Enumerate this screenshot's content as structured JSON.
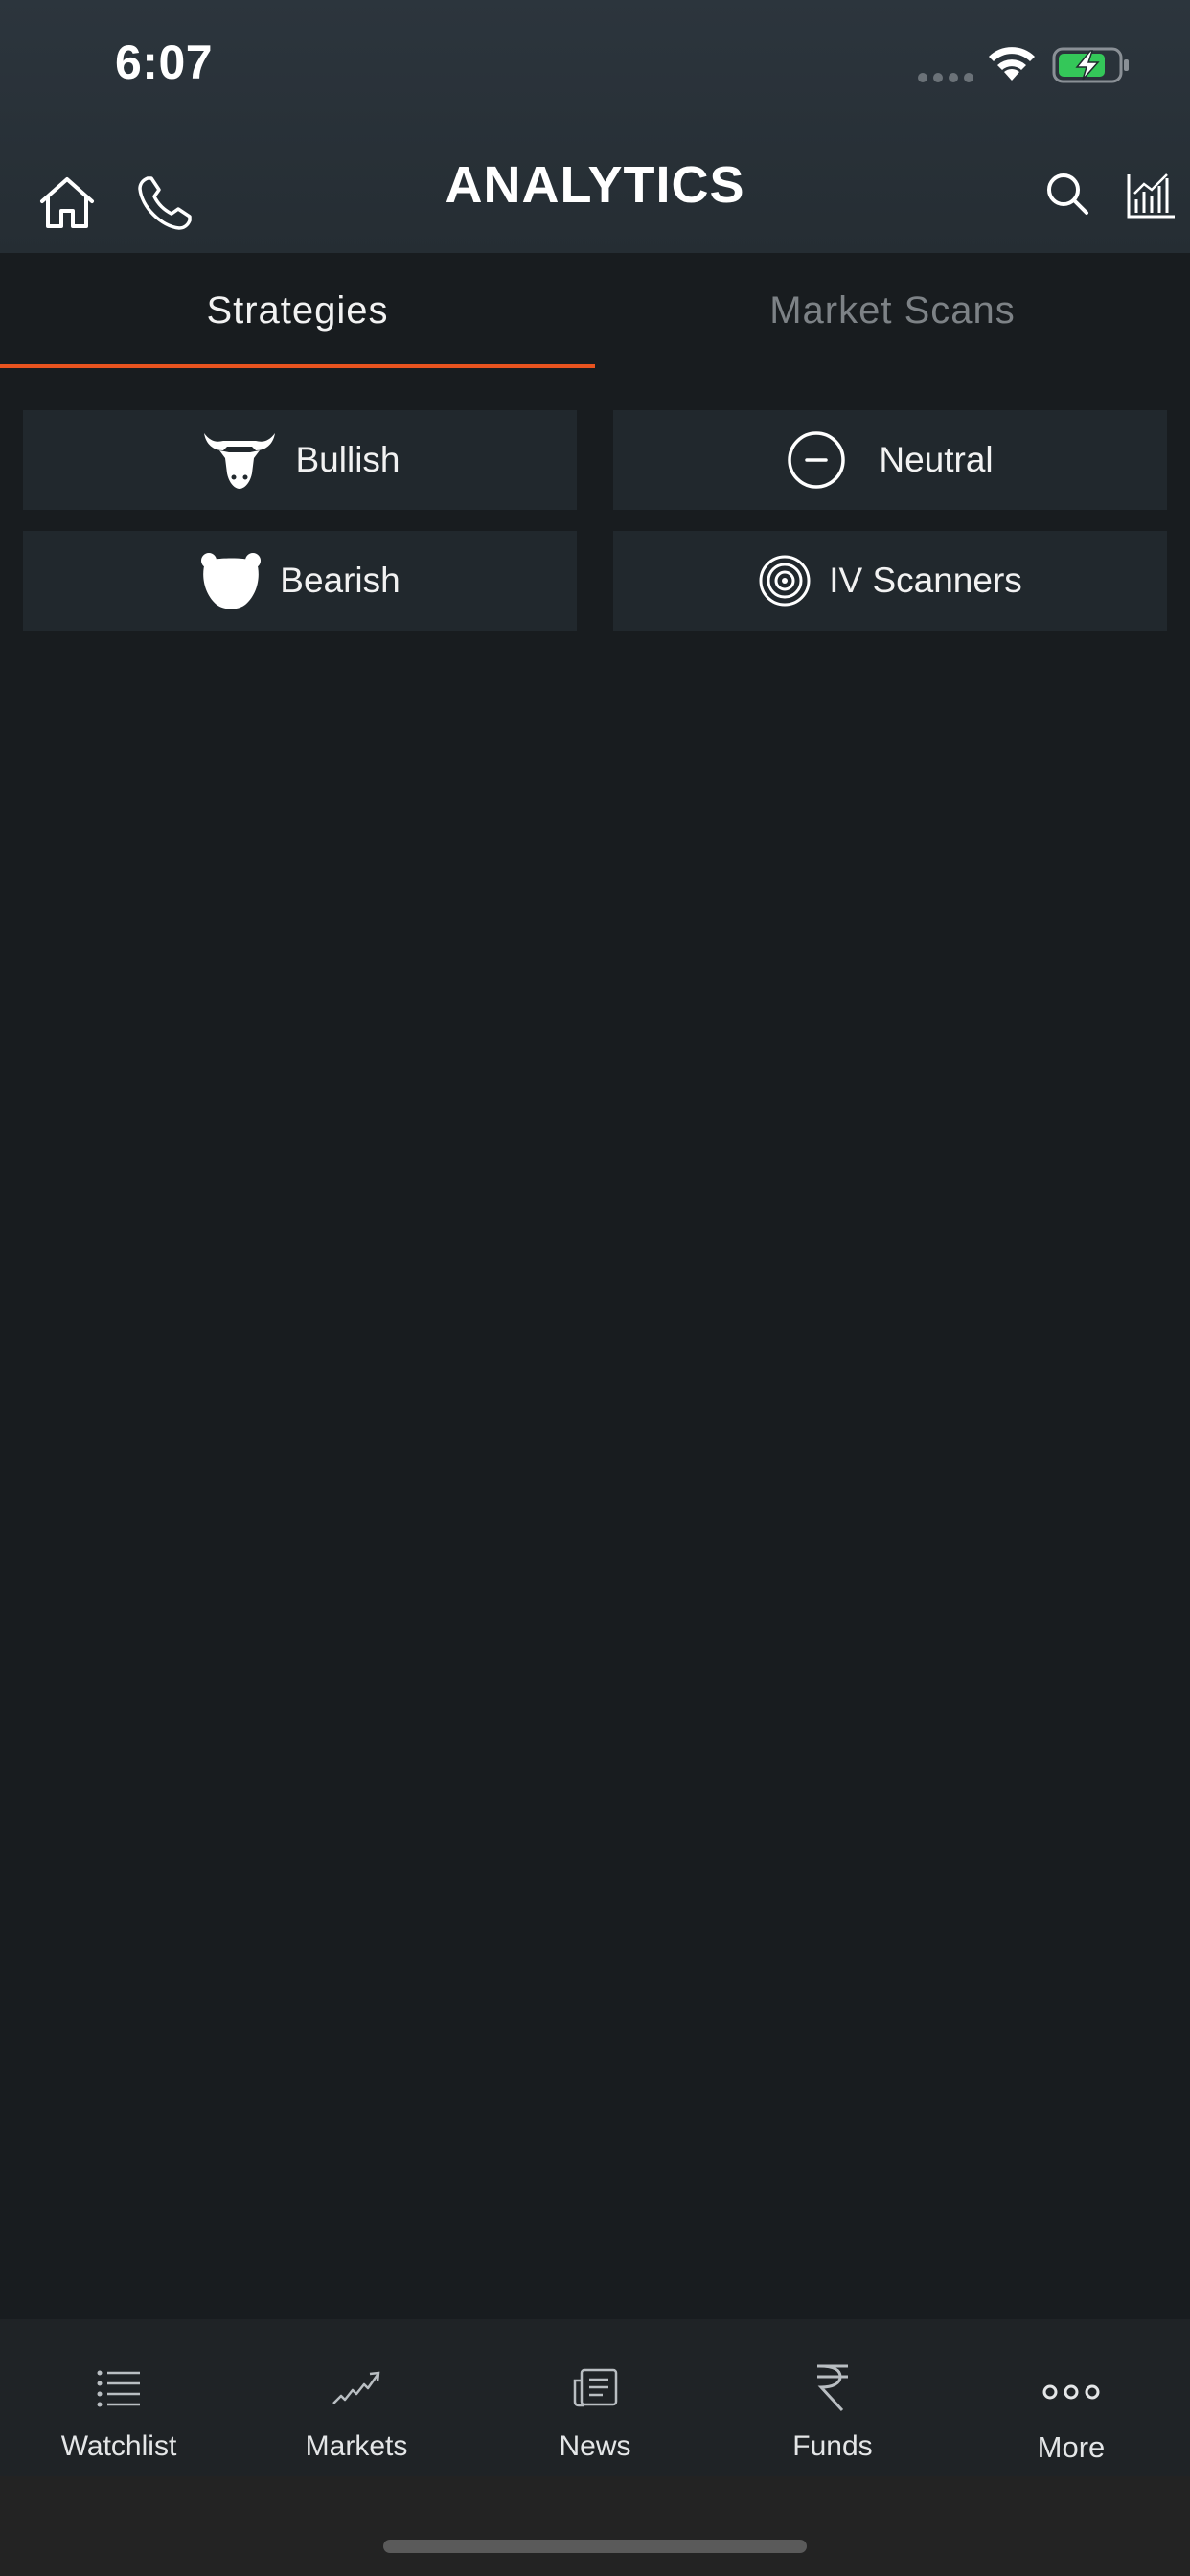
{
  "status_bar": {
    "time": "6:07"
  },
  "header": {
    "title": "ANALYTICS",
    "icons": [
      "home-icon",
      "phone-icon",
      "search-icon",
      "chart-icon"
    ]
  },
  "tabs": [
    {
      "label": "Strategies",
      "active": true
    },
    {
      "label": "Market Scans",
      "active": false
    }
  ],
  "strategies": {
    "bullish": {
      "label": "Bullish",
      "icon": "bull-icon"
    },
    "neutral": {
      "label": "Neutral",
      "icon": "minus-circle-icon"
    },
    "bearish": {
      "label": "Bearish",
      "icon": "bear-icon"
    },
    "iv_scanners": {
      "label": "IV Scanners",
      "icon": "target-icon"
    }
  },
  "bottom_nav": [
    {
      "label": "Watchlist",
      "icon": "list-icon"
    },
    {
      "label": "Markets",
      "icon": "trend-icon"
    },
    {
      "label": "News",
      "icon": "newspaper-icon"
    },
    {
      "label": "Funds",
      "icon": "rupee-icon"
    },
    {
      "label": "More",
      "icon": "more-dots-icon"
    }
  ],
  "colors": {
    "accent": "#e8531f",
    "background": "#181c1f",
    "card": "#21282d",
    "header": "#29323a",
    "battery_fill": "#34c759"
  }
}
